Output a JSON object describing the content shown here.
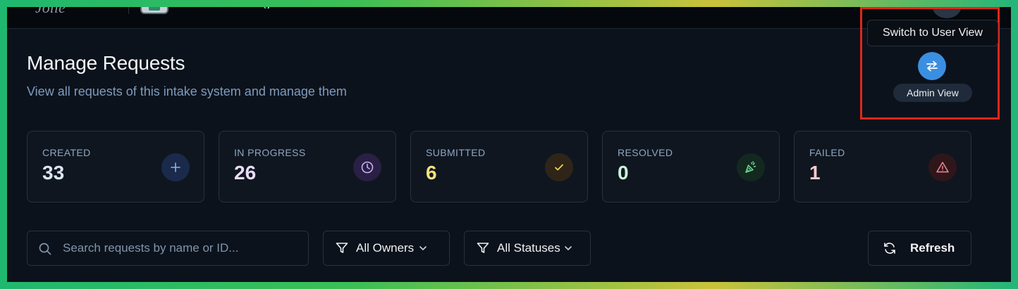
{
  "header": {
    "logo_text": "Jolie",
    "app_icon": "app-logo-icon",
    "app_name_fragment": "g",
    "avatar": "avatar"
  },
  "page": {
    "title": "Manage Requests",
    "subtitle": "View all requests of this intake system and manage them"
  },
  "view_toggle": {
    "tooltip": "Switch to User View",
    "button_icon": "swap-arrows-icon",
    "current_view_label": "Admin View",
    "highlight_color": "#e0261c",
    "button_color": "#3b8fe0"
  },
  "stats": [
    {
      "label": "CREATED",
      "value": "33",
      "icon": "plus-icon",
      "value_color": "#dbe5f3",
      "icon_bg": "#1a2a4a"
    },
    {
      "label": "IN PROGRESS",
      "value": "26",
      "icon": "clock-icon",
      "value_color": "#eadcf7",
      "icon_bg": "#2a1f45"
    },
    {
      "label": "SUBMITTED",
      "value": "6",
      "icon": "check-icon",
      "value_color": "#f6e27a",
      "icon_bg": "#2e2518"
    },
    {
      "label": "RESOLVED",
      "value": "0",
      "icon": "party-popper-icon",
      "value_color": "#c9f2d6",
      "icon_bg": "#13281f"
    },
    {
      "label": "FAILED",
      "value": "1",
      "icon": "warning-icon",
      "value_color": "#f6c9cf",
      "icon_bg": "#2e161b"
    }
  ],
  "toolbar": {
    "search_placeholder": "Search requests by name or ID...",
    "owners_filter": "All Owners",
    "status_filter": "All Statuses",
    "refresh_label": "Refresh"
  }
}
